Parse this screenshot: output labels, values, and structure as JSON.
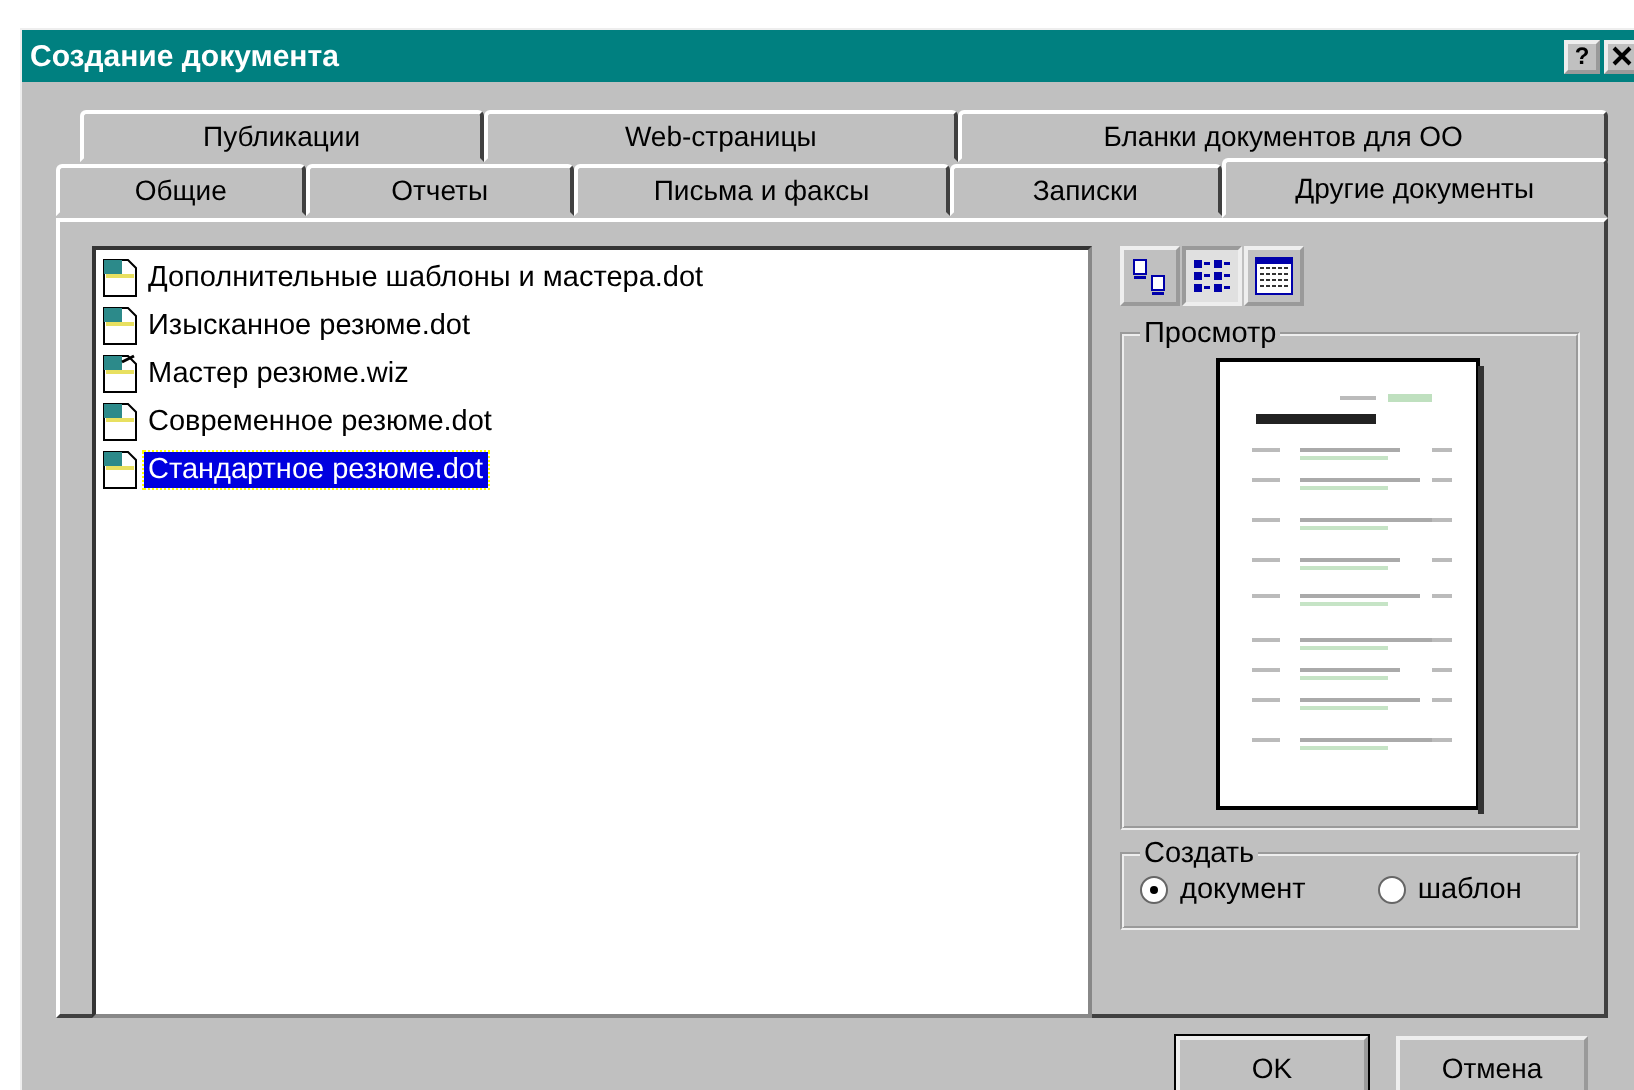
{
  "window": {
    "title": "Создание документа",
    "help_button": "?"
  },
  "tab_rows": [
    {
      "tabs": [
        {
          "label": "Публикации",
          "selected": false
        },
        {
          "label": "Web-страницы",
          "selected": false
        },
        {
          "label": "Бланки документов для ОО",
          "selected": false
        }
      ]
    },
    {
      "tabs": [
        {
          "label": "Общие",
          "selected": false
        },
        {
          "label": "Отчеты",
          "selected": false
        },
        {
          "label": "Письма и факсы",
          "selected": false
        },
        {
          "label": "Записки",
          "selected": false
        },
        {
          "label": "Другие документы",
          "selected": true
        }
      ]
    }
  ],
  "files": [
    {
      "name": "Дополнительные шаблоны и мастера.dot",
      "kind": "template",
      "selected": false
    },
    {
      "name": "Изысканное резюме.dot",
      "kind": "template",
      "selected": false
    },
    {
      "name": "Мастер резюме.wiz",
      "kind": "wizard",
      "selected": false
    },
    {
      "name": "Современное резюме.dot",
      "kind": "template",
      "selected": false
    },
    {
      "name": "Стандартное резюме.dot",
      "kind": "template",
      "selected": true
    }
  ],
  "view_buttons": [
    {
      "kind": "large-icons",
      "selected": false
    },
    {
      "kind": "list",
      "selected": true
    },
    {
      "kind": "details",
      "selected": false
    }
  ],
  "preview": {
    "label": "Просмотр"
  },
  "create": {
    "label": "Создать",
    "options": [
      {
        "label": "документ",
        "selected": true
      },
      {
        "label": "шаблон",
        "selected": false
      }
    ]
  },
  "buttons": [
    "OK",
    "Отмена"
  ]
}
